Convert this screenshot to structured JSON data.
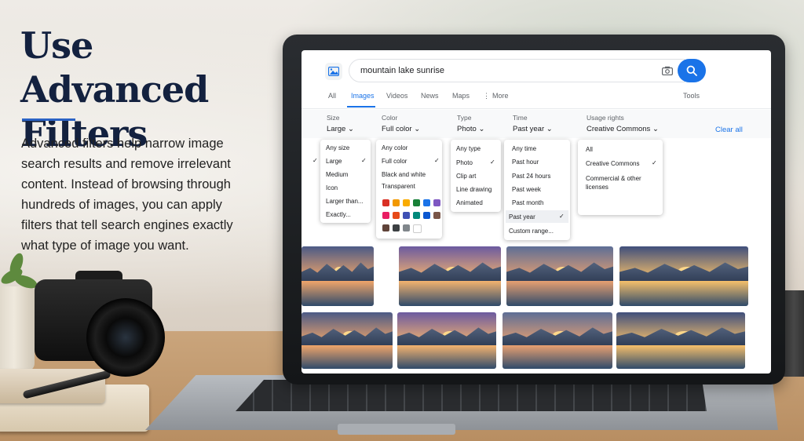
{
  "headline": "Use Advanced Filters",
  "description": "Advanced filters help narrow image search results and remove irrelevant content. Instead of browsing through hundreds of images, you can apply filters that tell search engines exactly what type of image you want.",
  "search": {
    "query": "mountain lake sunrise"
  },
  "tabs": [
    {
      "label": "All"
    },
    {
      "label": "Images"
    },
    {
      "label": "Videos"
    },
    {
      "label": "News"
    },
    {
      "label": "Maps"
    },
    {
      "label": "More"
    }
  ],
  "tools_label": "Tools",
  "filters": {
    "size": {
      "label": "Size",
      "value": "Large",
      "options": [
        "Any size",
        "Large",
        "Medium",
        "Icon",
        "Larger than...",
        "Exactly..."
      ]
    },
    "color": {
      "label": "Color",
      "value": "Full color",
      "options": [
        "Any color",
        "Full color",
        "Black and white",
        "Transparent"
      ],
      "swatches": [
        "#d93025",
        "#f29900",
        "#f9ab00",
        "#188038",
        "#1a73e8",
        "#7e57c2",
        "#e91e63",
        "#e64a19",
        "#3f51b5",
        "#00897b",
        "#0b57d0",
        "#795548",
        "#5f4339",
        "#3c4043",
        "#80868b",
        "#ffffff"
      ]
    },
    "type": {
      "label": "Type",
      "value": "Photo",
      "options": [
        "Any type",
        "Photo",
        "Clip art",
        "Line drawing",
        "Animated"
      ]
    },
    "time": {
      "label": "Time",
      "value": "Past year",
      "options": [
        "Any time",
        "Past hour",
        "Past 24 hours",
        "Past week",
        "Past month",
        "Past year",
        "Custom range..."
      ]
    },
    "usage": {
      "label": "Usage rights",
      "value": "Creative Commons",
      "options": [
        "All",
        "Creative Commons",
        "Commercial & other licenses"
      ]
    }
  },
  "clear_all": "Clear all",
  "colors": {
    "accent": "#1a73e8",
    "headline": "#13213f",
    "rule": "#2b63c4"
  }
}
